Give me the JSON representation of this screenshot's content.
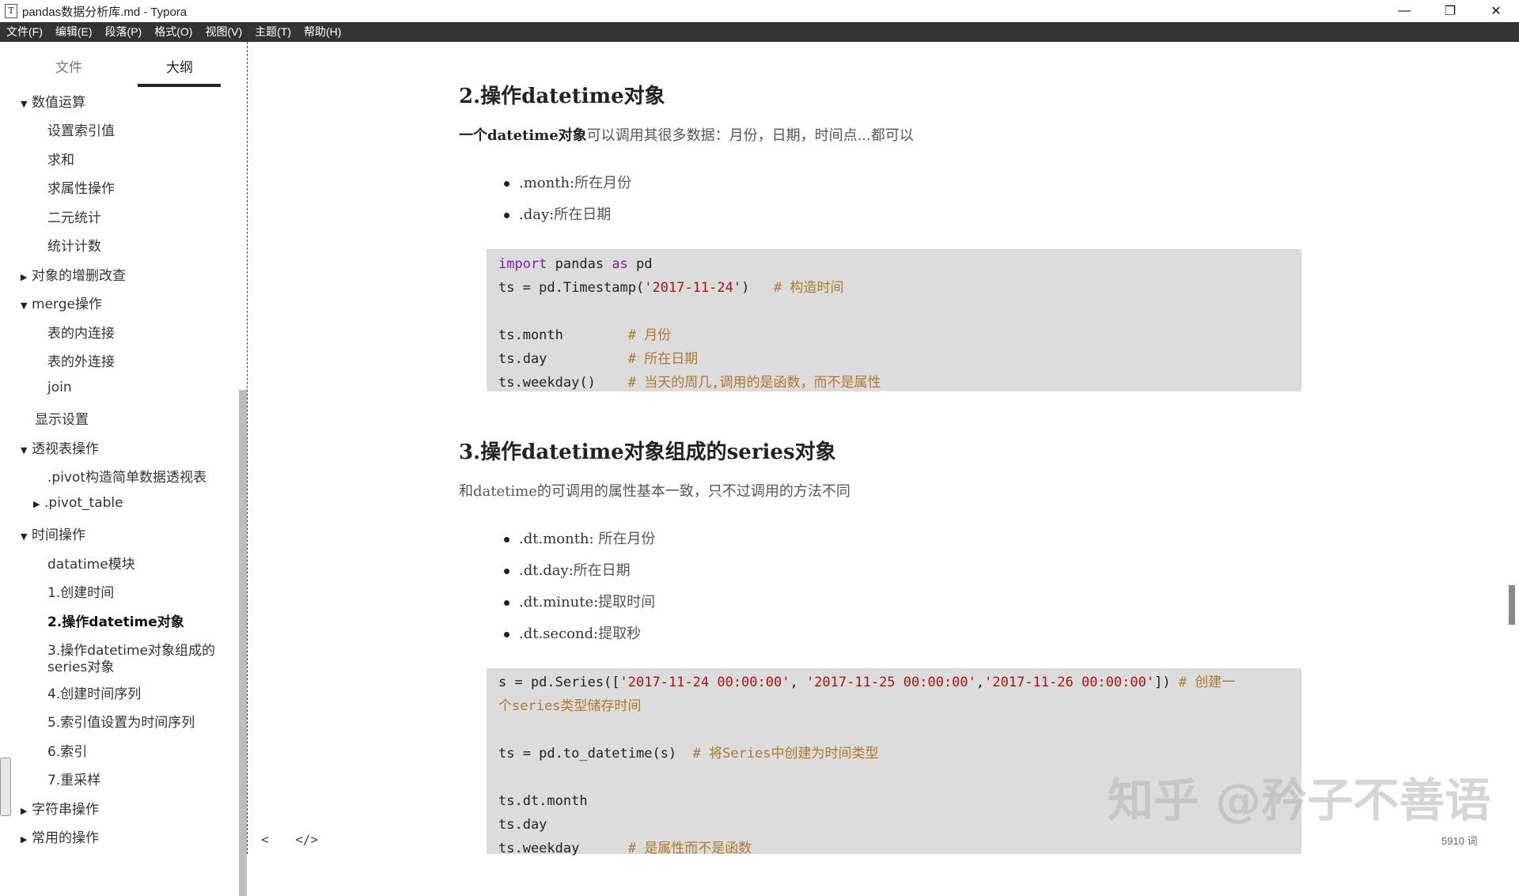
{
  "window": {
    "app_icon": "T",
    "title": "pandas数据分析库.md - Typora",
    "minimize": "—",
    "restore": "❐",
    "close": "✕"
  },
  "menu": [
    "文件(F)",
    "编辑(E)",
    "段落(P)",
    "格式(O)",
    "视图(V)",
    "主题(T)",
    "帮助(H)"
  ],
  "sidebar": {
    "tab_files": "文件",
    "tab_outline": "大纲",
    "outline": [
      {
        "label": "数值运算",
        "caret": "▼"
      },
      {
        "label": "设置索引值"
      },
      {
        "label": "求和"
      },
      {
        "label": "求属性操作"
      },
      {
        "label": "二元统计"
      },
      {
        "label": "统计计数"
      },
      {
        "label": "对象的增删改查",
        "caret": "▶"
      },
      {
        "label": "merge操作",
        "caret": "▼"
      },
      {
        "label": "表的内连接"
      },
      {
        "label": "表的外连接"
      },
      {
        "label": "join"
      },
      {
        "label": "显示设置"
      },
      {
        "label": "透视表操作",
        "caret": "▼"
      },
      {
        "label": ".pivot构造简单数据透视表"
      },
      {
        "label": ".pivot_table",
        "caret": "▶"
      },
      {
        "label": "时间操作",
        "caret": "▼"
      },
      {
        "label": "datatime模块"
      },
      {
        "label": "1.创建时间"
      },
      {
        "label": "2.操作datetime对象"
      },
      {
        "label": "3.操作datetime对象组成的"
      },
      {
        "label": "series对象"
      },
      {
        "label": "4.创建时间序列"
      },
      {
        "label": "5.索引值设置为时间序列"
      },
      {
        "label": "6.索引"
      },
      {
        "label": "7.重采样"
      },
      {
        "label": "字符串操作",
        "caret": "▶"
      },
      {
        "label": "常用的操作",
        "caret": "▶"
      }
    ]
  },
  "doc": {
    "h2_1": "2.操作datetime对象",
    "p1_bold": "一个datetime对象",
    "p1_rest": "可以调用其很多数据：月份，日期，时间点...都可以",
    "bullets1": [
      {
        "k": ".month:",
        "v": "所在月份"
      },
      {
        "k": ".day:",
        "v": "所在日期"
      }
    ],
    "code1": {
      "l1_kw1": "import",
      "l1_mid": " pandas ",
      "l1_kw2": "as",
      "l1_end": " pd",
      "l2_a": "ts = pd.Timestamp(",
      "l2_str": "'2017-11-24'",
      "l2_b": ")   ",
      "l2_cmt": "# 构造时间",
      "l4_a": "ts.month        ",
      "l4_cmt": "# 月份",
      "l5_a": "ts.day          ",
      "l5_cmt": "# 所在日期",
      "l6_a": "ts.weekday()    ",
      "l6_cmt": "# 当天的周几,调用的是函数，而不是属性"
    },
    "h2_2": "3.操作datetime对象组成的series对象",
    "p2": "和datetime的可调用的属性基本一致，只不过调用的方法不同",
    "bullets2": [
      {
        "k": ".dt.month:",
        "v": " 所在月份"
      },
      {
        "k": ".dt.day:",
        "v": "所在日期"
      },
      {
        "k": ".dt.minute:",
        "v": "提取时间"
      },
      {
        "k": ".dt.second:",
        "v": "提取秒"
      }
    ],
    "code2": {
      "l1_a": "s = pd.Series([",
      "l1_s1": "'2017-11-24 00:00:00'",
      "l1_c1": ", ",
      "l1_s2": "'2017-11-25 00:00:00'",
      "l1_c2": ",",
      "l1_s3": "'2017-11-26 00:00:00'",
      "l1_b": "]) ",
      "l1_cmt": "# 创建一",
      "l2_cmt": "个series类型储存时间",
      "l4_a": "ts = pd.to_datetime(s)  ",
      "l4_cmt": "# 将Series中创建为时间类型",
      "l6_a": "ts.dt.month",
      "l7_a": "ts.day",
      "l8_a": "ts.weekday      ",
      "l8_cmt": "# 是属性而不是函数"
    }
  },
  "status": {
    "back_icon": "<",
    "source_icon": "</>",
    "word_count": "5910 词"
  },
  "watermark": "知乎 @矜子不善语"
}
